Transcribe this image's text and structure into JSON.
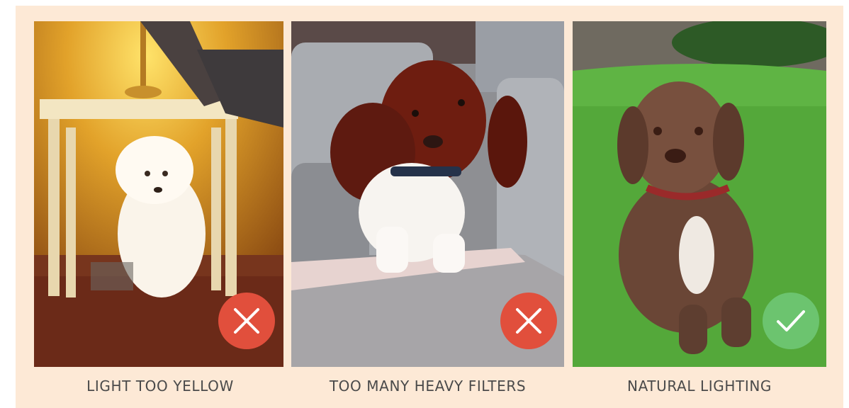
{
  "colors": {
    "background": "#fde9d6",
    "reject_badge": "#e14f3c",
    "approve_badge": "#6cc46f",
    "caption_text": "#4a4a4a"
  },
  "examples": [
    {
      "caption": "LIGHT TOO YELLOW",
      "verdict": "rejected",
      "badge_icon": "x-icon"
    },
    {
      "caption": "TOO MANY HEAVY FILTERS",
      "verdict": "rejected",
      "badge_icon": "x-icon"
    },
    {
      "caption": "NATURAL LIGHTING",
      "verdict": "approved",
      "badge_icon": "check-icon"
    }
  ]
}
